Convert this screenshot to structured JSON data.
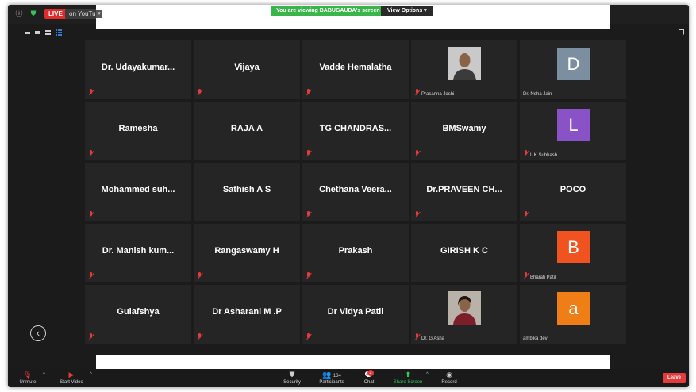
{
  "topbar": {
    "live_label": "LIVE",
    "platform_label": "on YouTube",
    "viewing_banner": "You are viewing BABUGAUDA's screen",
    "view_options_label": "View Options"
  },
  "participants": [
    {
      "name": "Dr. Udayakumar...",
      "type": "name",
      "muted": true
    },
    {
      "name": "Vijaya",
      "type": "name",
      "muted": true
    },
    {
      "name": "Vadde Hemalatha",
      "type": "name",
      "muted": true
    },
    {
      "name": "Prasanna Joshi",
      "type": "photo",
      "muted": true
    },
    {
      "name": "Dr. Neha Jain",
      "type": "letter",
      "letter": "D",
      "color": "#7b8fa0",
      "muted": false
    },
    {
      "name": "Ramesha",
      "type": "name",
      "muted": true
    },
    {
      "name": "RAJA A",
      "type": "name",
      "muted": false
    },
    {
      "name": "TG CHANDRAS...",
      "type": "name",
      "muted": true
    },
    {
      "name": "BMSwamy",
      "type": "name",
      "muted": true
    },
    {
      "name": "L K Subhash",
      "type": "letter",
      "letter": "L",
      "color": "#8a52c7",
      "muted": true
    },
    {
      "name": "Mohammed suh...",
      "type": "name",
      "muted": true
    },
    {
      "name": "Sathish A S",
      "type": "name",
      "muted": false
    },
    {
      "name": "Chethana Veera...",
      "type": "name",
      "muted": true
    },
    {
      "name": "Dr.PRAVEEN CH...",
      "type": "name",
      "muted": true
    },
    {
      "name": "POCO",
      "type": "name",
      "muted": true
    },
    {
      "name": "Dr. Manish kum...",
      "type": "name",
      "muted": true
    },
    {
      "name": "Rangaswamy H",
      "type": "name",
      "muted": true
    },
    {
      "name": "Prakash",
      "type": "name",
      "muted": true
    },
    {
      "name": "GIRISH K C",
      "type": "name",
      "muted": false
    },
    {
      "name": "Bharati Patil",
      "type": "letter",
      "letter": "B",
      "color": "#f0531f",
      "muted": true
    },
    {
      "name": "Gulafshya",
      "type": "name",
      "muted": true
    },
    {
      "name": "Dr Asharani M .P",
      "type": "name",
      "muted": true
    },
    {
      "name": "Dr Vidya Patil",
      "type": "name",
      "muted": true
    },
    {
      "name": "Dr. G Asha",
      "type": "photo",
      "muted": true
    },
    {
      "name": "ambika devi",
      "type": "letter",
      "letter": "a",
      "color": "#f07e16",
      "muted": false
    }
  ],
  "toolbar": {
    "unmute_label": "Unmute",
    "start_video_label": "Start Video",
    "security_label": "Security",
    "participants_label": "Participants",
    "participants_count": "134",
    "chat_label": "Chat",
    "chat_badge": "2",
    "share_screen_label": "Share Screen",
    "record_label": "Record",
    "leave_label": "Leave"
  },
  "icons": {
    "back": "chevron-left-icon",
    "fullscreen": "fullscreen-icon"
  }
}
